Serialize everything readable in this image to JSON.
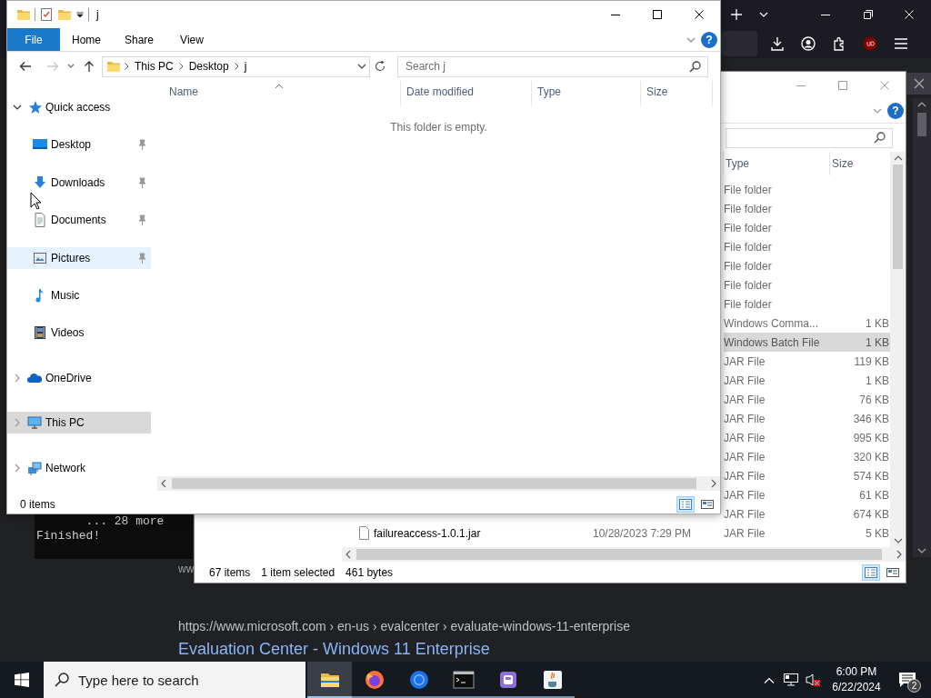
{
  "browser": {
    "terminal_lines": [
      "... 28 more",
      "Finished!"
    ],
    "clipped_link": "ww",
    "result": {
      "url": "https://www.microsoft.com",
      "path": "› en-us › evalcenter › evaluate-windows-11-enterprise",
      "title": "Evaluation Center - Windows 11 Enterprise"
    }
  },
  "background_window": {
    "help": "?",
    "columns": [
      "Type",
      "Size"
    ],
    "rows": [
      {
        "type": "File folder",
        "selected": false
      },
      {
        "type": "File folder",
        "selected": false
      },
      {
        "type": "File folder",
        "selected": false
      },
      {
        "type": "File folder",
        "selected": false
      },
      {
        "type": "File folder",
        "selected": false
      },
      {
        "type": "File folder",
        "selected": false
      },
      {
        "type": "File folder",
        "selected": false
      },
      {
        "type": "Windows Comma...",
        "size": "1 KB",
        "selected": false
      },
      {
        "type": "Windows Batch File",
        "size": "1 KB",
        "selected": true
      },
      {
        "type": "JAR File",
        "size": "119 KB",
        "selected": false
      },
      {
        "type": "JAR File",
        "size": "1 KB",
        "selected": false
      },
      {
        "type": "JAR File",
        "size": "76 KB",
        "selected": false
      },
      {
        "type": "JAR File",
        "size": "346 KB",
        "selected": false
      },
      {
        "type": "JAR File",
        "size": "995 KB",
        "selected": false
      },
      {
        "type": "JAR File",
        "size": "320 KB",
        "selected": false
      },
      {
        "type": "JAR File",
        "size": "574 KB",
        "selected": false
      },
      {
        "type": "JAR File",
        "size": "61 KB",
        "selected": false
      },
      {
        "type": "JAR File",
        "size": "674 KB",
        "selected": false
      },
      {
        "name": "failureaccess-1.0.1.jar",
        "date": "10/28/2023 7:29 PM",
        "type": "JAR File",
        "size": "5 KB",
        "selected": false
      }
    ],
    "status": [
      "67 items",
      "1 item selected",
      "461 bytes"
    ]
  },
  "window": {
    "title": "j",
    "help": "?",
    "ribbon_tabs": [
      {
        "label": "File",
        "kind": "menu"
      },
      {
        "label": "Home",
        "kind": "tab"
      },
      {
        "label": "Share",
        "kind": "tab"
      },
      {
        "label": "View",
        "kind": "tab"
      }
    ],
    "address": [
      "This PC",
      "Desktop",
      "j"
    ],
    "search": {
      "placeholder": "Search j"
    },
    "sidebar": {
      "items": [
        {
          "label": "Quick access",
          "expanded": true,
          "selected": false,
          "children": [
            {
              "label": "Desktop",
              "pinned": true,
              "hovered": false,
              "selected": false
            },
            {
              "label": "Downloads",
              "pinned": true,
              "hovered": false,
              "selected": false
            },
            {
              "label": "Documents",
              "pinned": true,
              "hovered": false,
              "selected": false
            },
            {
              "label": "Pictures",
              "pinned": true,
              "hovered": true,
              "selected": false
            },
            {
              "label": "Music",
              "pinned": false,
              "hovered": false,
              "selected": false
            },
            {
              "label": "Videos",
              "pinned": false,
              "hovered": false,
              "selected": false
            }
          ]
        },
        {
          "label": "OneDrive",
          "expanded": false,
          "selected": false
        },
        {
          "label": "This PC",
          "expanded": false,
          "selected": true
        },
        {
          "label": "Network",
          "expanded": false,
          "selected": false
        }
      ]
    },
    "columns": [
      {
        "label": "Name",
        "sorted": true
      },
      {
        "label": "Date modified",
        "sorted": false
      },
      {
        "label": "Type",
        "sorted": false
      },
      {
        "label": "Size",
        "sorted": false
      }
    ],
    "empty_message": "This folder is empty.",
    "status_bar": "0 items"
  },
  "taskbar": {
    "search": {
      "placeholder": "Type here to search"
    },
    "apps": [
      {
        "active": true
      },
      {
        "active": false
      },
      {
        "active": false
      },
      {
        "active": false
      },
      {
        "active": false
      },
      {
        "active": false
      }
    ],
    "time": "6:00 PM",
    "date": "6/22/2024",
    "notifications": "2"
  }
}
